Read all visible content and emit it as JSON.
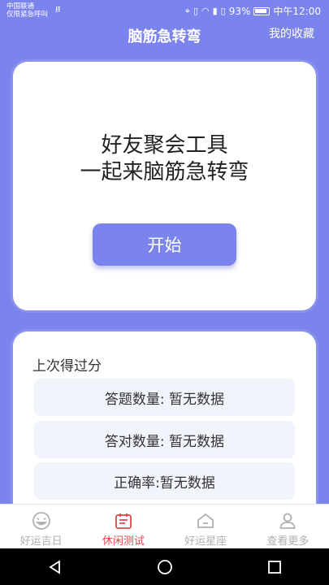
{
  "status_bar": {
    "carrier_line1": "中国联通",
    "carrier_line2": "仅限紧急呼叫",
    "battery_percent": "93%",
    "time": "中午12:00"
  },
  "header": {
    "title": "脑筋急转弯",
    "favorites_label": "我的收藏"
  },
  "hero": {
    "line1": "好友聚会工具",
    "line2": "一起来脑筋急转弯",
    "start_label": "开始"
  },
  "last_score": {
    "title": "上次得过分",
    "rows": [
      "答题数量: 暂无数据",
      "答对数量: 暂无数据",
      "正确率:暂无数据"
    ]
  },
  "tabs": [
    {
      "label": "好运吉日",
      "icon": "smiley-face-icon",
      "active": false
    },
    {
      "label": "休闲测试",
      "icon": "calendar-list-icon",
      "active": true
    },
    {
      "label": "好运星座",
      "icon": "home-icon",
      "active": false
    },
    {
      "label": "查看更多",
      "icon": "user-icon",
      "active": false
    }
  ],
  "colors": {
    "primary": "#7b83ec",
    "active_tab": "#e4474c",
    "inactive_tab": "#b0b0b0"
  }
}
